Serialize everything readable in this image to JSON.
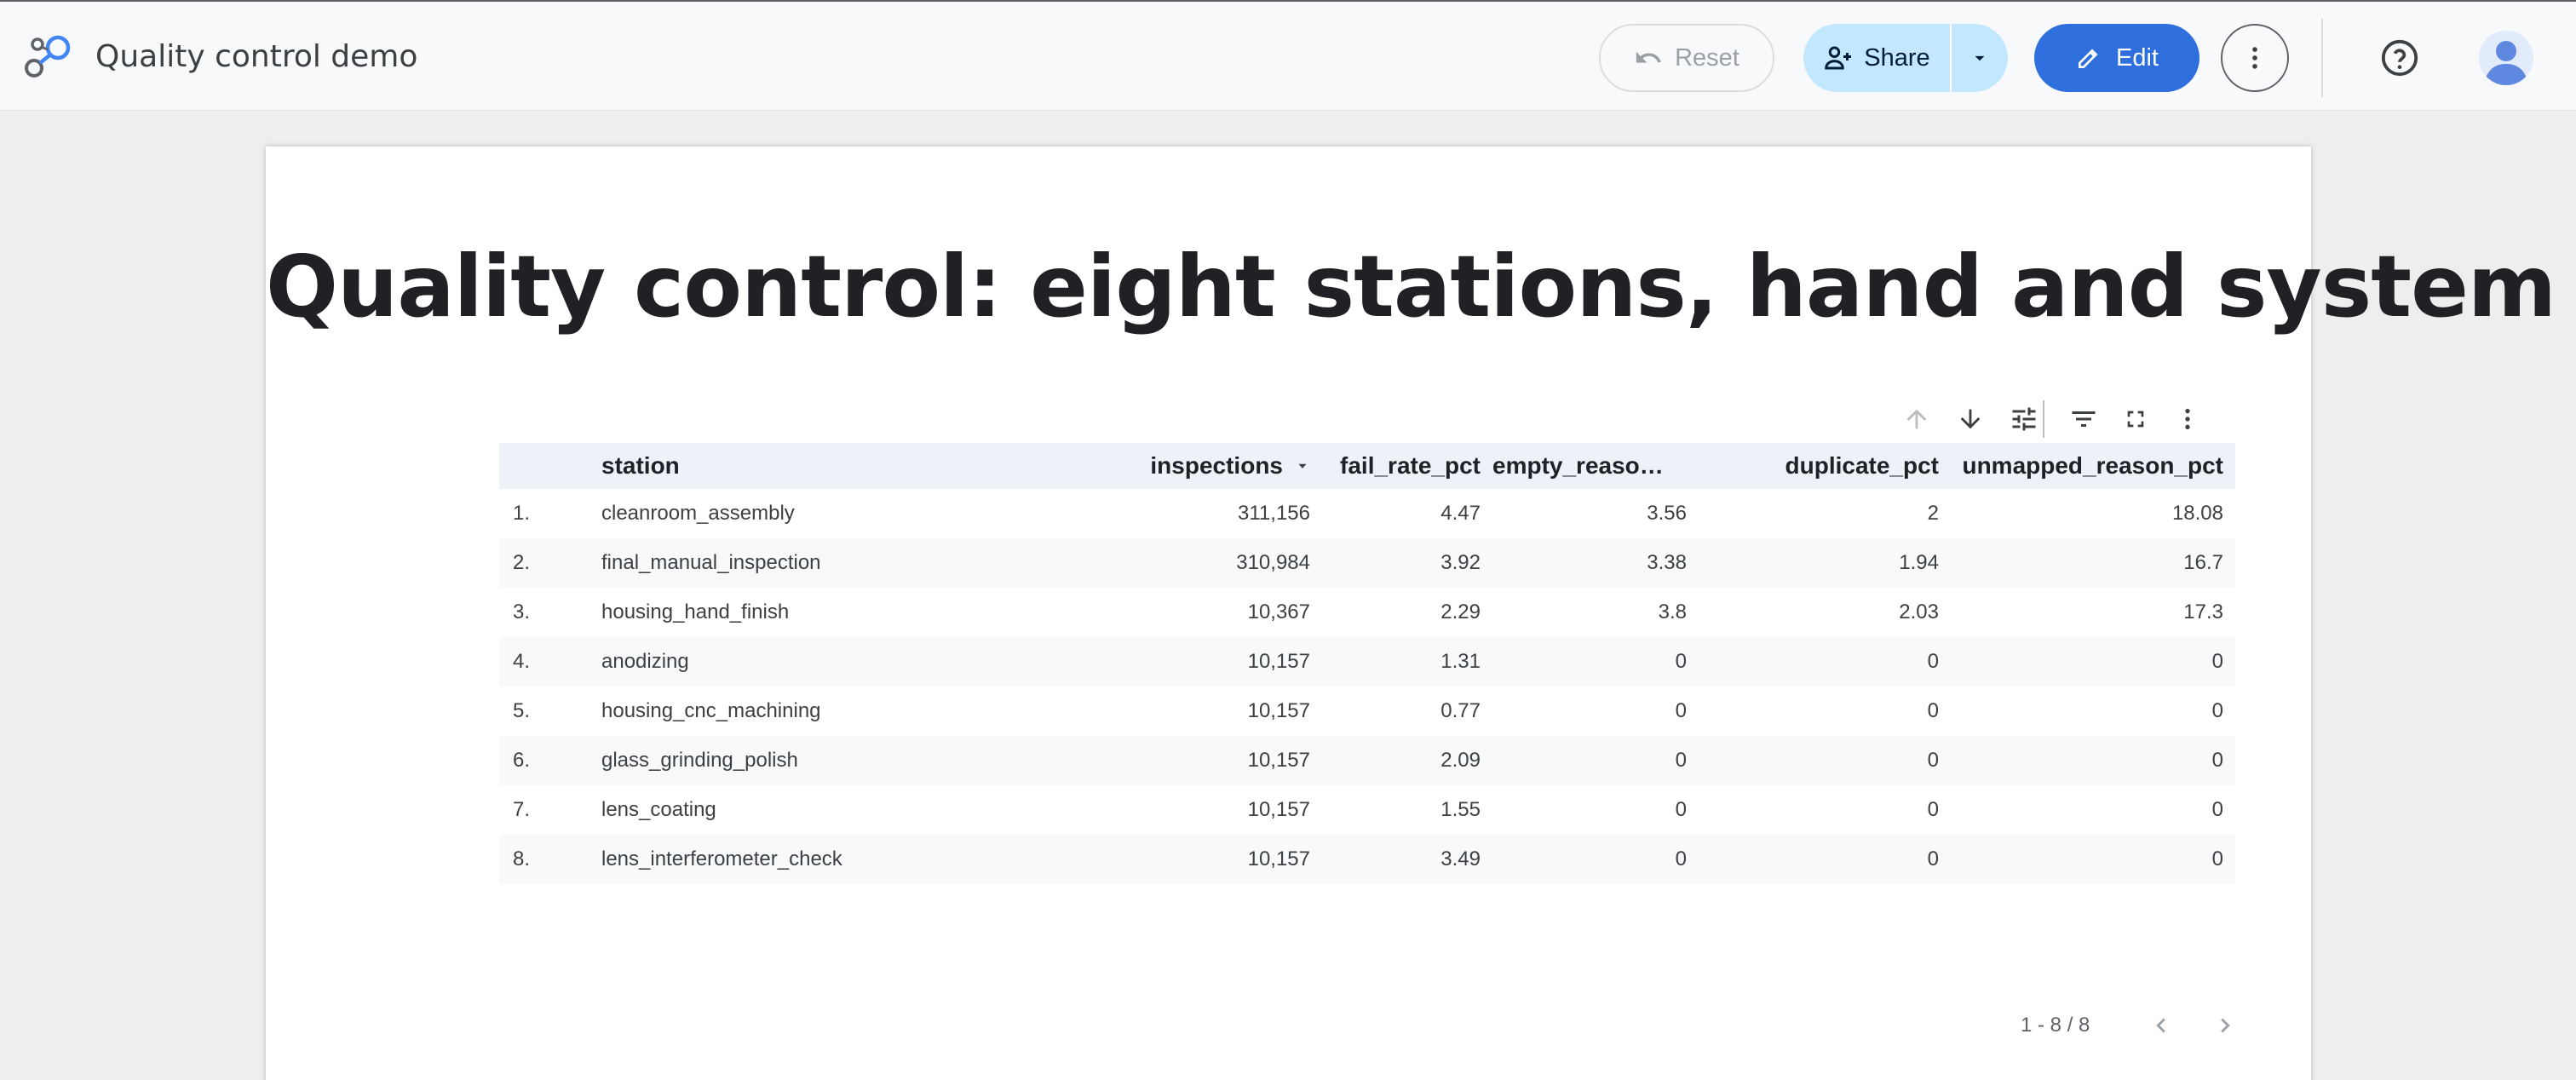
{
  "header": {
    "app_title": "Quality control demo",
    "reset_label": "Reset",
    "share_label": "Share",
    "edit_label": "Edit",
    "icons": {
      "logo": "looker-studio-logo-icon",
      "reset": "undo-icon",
      "share": "person-add-icon",
      "share_menu": "caret-down-icon",
      "edit": "pencil-icon",
      "more": "more-vert-icon",
      "help": "help-circle-icon",
      "avatar": "account-avatar-icon"
    },
    "colors": {
      "edit_bg": "#2f6fdd",
      "share_bg": "#c2e7ff"
    }
  },
  "report": {
    "title": "Quality control: eight stations, hand and system"
  },
  "table": {
    "toolbar_icons": [
      "sort-ascending-icon",
      "sort-descending-icon",
      "tune-icon",
      "filter-icon",
      "fullscreen-icon",
      "more-vert-icon"
    ],
    "columns": {
      "station": "station",
      "inspections": "inspections",
      "fail_rate_pct": "fail_rate_pct",
      "empty_reason": "empty_reaso…",
      "duplicate_pct": "duplicate_pct",
      "unmapped_reason_pct": "unmapped_reason_pct"
    },
    "sort": {
      "column": "inspections",
      "direction": "descending"
    },
    "rows": [
      {
        "idx": "1.",
        "station": "cleanroom_assembly",
        "inspections": "311,156",
        "fail": "4.47",
        "empty": "3.56",
        "dup": "2",
        "unmap": "18.08"
      },
      {
        "idx": "2.",
        "station": "final_manual_inspection",
        "inspections": "310,984",
        "fail": "3.92",
        "empty": "3.38",
        "dup": "1.94",
        "unmap": "16.7"
      },
      {
        "idx": "3.",
        "station": "housing_hand_finish",
        "inspections": "10,367",
        "fail": "2.29",
        "empty": "3.8",
        "dup": "2.03",
        "unmap": "17.3"
      },
      {
        "idx": "4.",
        "station": "anodizing",
        "inspections": "10,157",
        "fail": "1.31",
        "empty": "0",
        "dup": "0",
        "unmap": "0"
      },
      {
        "idx": "5.",
        "station": "housing_cnc_machining",
        "inspections": "10,157",
        "fail": "0.77",
        "empty": "0",
        "dup": "0",
        "unmap": "0"
      },
      {
        "idx": "6.",
        "station": "glass_grinding_polish",
        "inspections": "10,157",
        "fail": "2.09",
        "empty": "0",
        "dup": "0",
        "unmap": "0"
      },
      {
        "idx": "7.",
        "station": "lens_coating",
        "inspections": "10,157",
        "fail": "1.55",
        "empty": "0",
        "dup": "0",
        "unmap": "0"
      },
      {
        "idx": "8.",
        "station": "lens_interferometer_check",
        "inspections": "10,157",
        "fail": "3.49",
        "empty": "0",
        "dup": "0",
        "unmap": "0"
      }
    ],
    "pagination": {
      "range": "1 - 8 / 8",
      "prev_icon": "chevron-left-icon",
      "next_icon": "chevron-right-icon"
    }
  }
}
